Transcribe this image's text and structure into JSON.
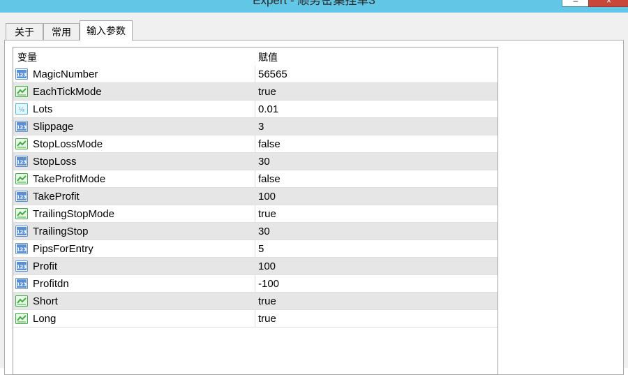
{
  "window": {
    "title": "Expert - 顺势密集挂单3",
    "minimize_glyph": "–",
    "close_glyph": "×"
  },
  "tabs": [
    {
      "label": "关于",
      "selected": false
    },
    {
      "label": "常用",
      "selected": false
    },
    {
      "label": "输入参数",
      "selected": true
    }
  ],
  "table": {
    "columns": {
      "variable": "变量",
      "value": "赋值"
    },
    "rows": [
      {
        "icon": "integer-icon",
        "name": "MagicNumber",
        "value": "56565"
      },
      {
        "icon": "boolean-icon",
        "name": "EachTickMode",
        "value": "true"
      },
      {
        "icon": "double-icon",
        "name": "Lots",
        "value": "0.01"
      },
      {
        "icon": "integer-icon",
        "name": "Slippage",
        "value": "3"
      },
      {
        "icon": "boolean-icon",
        "name": "StopLossMode",
        "value": "false"
      },
      {
        "icon": "integer-icon",
        "name": "StopLoss",
        "value": "30"
      },
      {
        "icon": "boolean-icon",
        "name": "TakeProfitMode",
        "value": "false"
      },
      {
        "icon": "integer-icon",
        "name": "TakeProfit",
        "value": "100"
      },
      {
        "icon": "boolean-icon",
        "name": "TrailingStopMode",
        "value": "true"
      },
      {
        "icon": "integer-icon",
        "name": "TrailingStop",
        "value": "30"
      },
      {
        "icon": "integer-icon",
        "name": "PipsForEntry",
        "value": "5"
      },
      {
        "icon": "integer-icon",
        "name": "Profit",
        "value": "100"
      },
      {
        "icon": "integer-icon",
        "name": "Profitdn",
        "value": "-100"
      },
      {
        "icon": "boolean-icon",
        "name": "Short",
        "value": "true"
      },
      {
        "icon": "boolean-icon",
        "name": "Long",
        "value": "true"
      }
    ]
  },
  "colors": {
    "title_bar": "#62c6e6",
    "alt_row": "#e6e6e6",
    "integer_icon": "#5b8fd4",
    "boolean_icon": "#3fae3f",
    "double_icon": "#4fb3e0"
  }
}
